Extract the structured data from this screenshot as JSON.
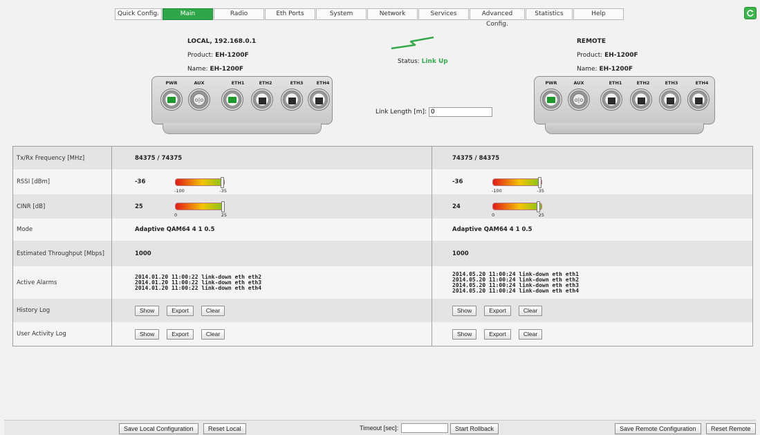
{
  "nav": {
    "tabs": [
      {
        "label": "Quick Config."
      },
      {
        "label": "Main"
      },
      {
        "label": "Radio"
      },
      {
        "label": "Eth Ports"
      },
      {
        "label": "System"
      },
      {
        "label": "Network"
      },
      {
        "label": "Services"
      },
      {
        "label": "Advanced Config."
      },
      {
        "label": "Statistics"
      },
      {
        "label": "Help"
      }
    ],
    "active": "Main"
  },
  "local": {
    "title": "LOCAL, 192.168.0.1",
    "product_label": "Product:",
    "product": "EH-1200F",
    "name_label": "Name:",
    "name": "EH-1200F"
  },
  "remote": {
    "title": "REMOTE",
    "product_label": "Product:",
    "product": "EH-1200F",
    "name_label": "Name:",
    "name": "EH-1200F"
  },
  "status": {
    "label": "Status:",
    "value": "Link Up"
  },
  "link_length": {
    "label": "Link Length [m]:",
    "value": "0"
  },
  "ports": {
    "pwr": "PWR",
    "aux": "AUX",
    "eth1": "ETH1",
    "eth2": "ETH2",
    "eth3": "ETH3",
    "eth4": "ETH4"
  },
  "table": {
    "rows": {
      "freq": {
        "label": "Tx/Rx Frequency [MHz]",
        "local": "84375 / 74375",
        "remote": "74375 / 84375"
      },
      "rssi": {
        "label": "RSSI [dBm]",
        "local": "-36",
        "remote": "-36",
        "min": "-100",
        "max": "-35",
        "local_level": 0.98,
        "remote_level": 0.98
      },
      "cinr": {
        "label": "CINR [dB]",
        "local": "25",
        "remote": "24",
        "min": "0",
        "max": "25",
        "local_level": 1.0,
        "remote_level": 0.96
      },
      "mode": {
        "label": "Mode",
        "local": "Adaptive QAM64 4 1 0.5",
        "remote": "Adaptive QAM64 4 1 0.5"
      },
      "throughput": {
        "label": "Estimated Throughput [Mbps]",
        "local": "1000",
        "remote": "1000"
      },
      "alarms": {
        "label": "Active Alarms",
        "local": [
          "2014.01.20 11:00:22 link-down eth eth2",
          "2014.01.20 11:00:22 link-down eth eth3",
          "2014.01.20 11:00:22 link-down eth eth4"
        ],
        "remote": [
          "2014.05.20 11:00:24 link-down eth eth1",
          "2014.05.20 11:00:24 link-down eth eth2",
          "2014.05.20 11:00:24 link-down eth eth3",
          "2014.05.20 11:00:24 link-down eth eth4"
        ]
      },
      "history": {
        "label": "History Log"
      },
      "user_activity": {
        "label": "User Activity Log"
      }
    },
    "buttons": {
      "show": "Show",
      "export": "Export",
      "clear": "Clear"
    }
  },
  "bottom": {
    "save_local": "Save Local Configuration",
    "reset_local": "Reset Local",
    "timeout_label": "Timeout [sec]:",
    "timeout_value": "",
    "start_rollback": "Start Rollback",
    "save_remote": "Save Remote Configuration",
    "reset_remote": "Reset Remote"
  },
  "colors": {
    "accent": "#2fa64a",
    "status_ok": "#35a94a"
  }
}
